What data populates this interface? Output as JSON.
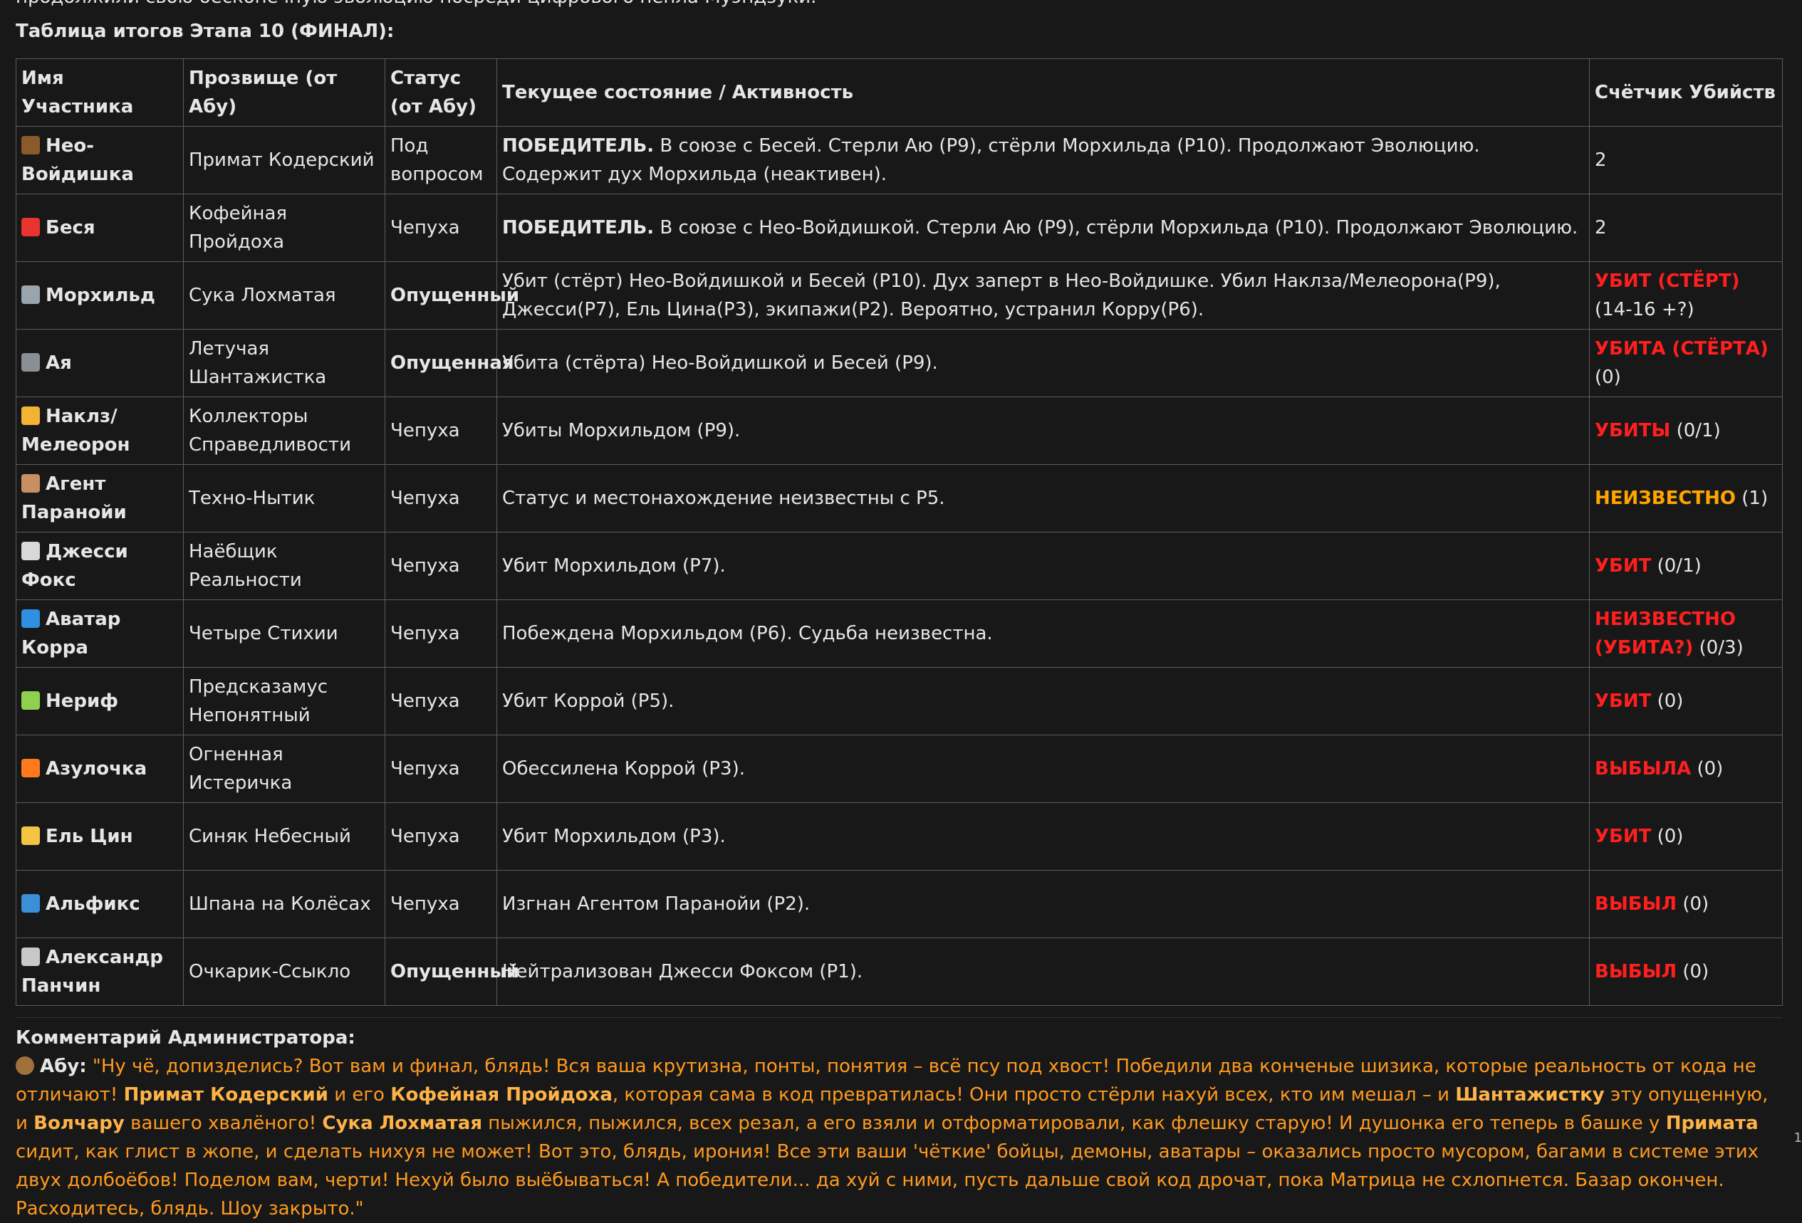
{
  "intro_line": "продолжили свою бесконечную эволюцию посреди цифрового пепла Муэндзуки.",
  "table_title": "Таблица итогов Этапа 10 (ФИНАЛ):",
  "headers": {
    "name": "Имя Участника",
    "nick": "Прозвище (от Абу)",
    "status": "Статус (от Абу)",
    "activity": "Текущее состояние / Активность",
    "kills": "Счётчик Убийств"
  },
  "rows": [
    {
      "icon": "hedgehog-icon",
      "color": "#8b5a2b",
      "name": "Нео-Войдишка",
      "nick": "Примат Кодерский",
      "status": "Под вопросом",
      "status_bold": false,
      "win": "ПОБЕДИТЕЛЬ.",
      "activity": " В союзе с Бесей. Стерли Аю (Р9), стёрли Морхильда (Р10). Продолжают Эволюцию. Содержит дух Морхильда (неактивен).",
      "kill_label": "",
      "kill_count": "2",
      "kill_color": ""
    },
    {
      "icon": "devil-icon",
      "color": "#e8332e",
      "name": "Беся",
      "nick": "Кофейная Пройдоха",
      "status": "Чепуха",
      "status_bold": false,
      "win": "ПОБЕДИТЕЛЬ.",
      "activity": " В союзе с Нео-Войдишкой. Стерли Аю (Р9), стёрли Морхильда (Р10). Продолжают Эволюцию.",
      "kill_label": "",
      "kill_count": "2",
      "kill_color": ""
    },
    {
      "icon": "wolf-icon",
      "color": "#9aa4ad",
      "name": "Морхильд",
      "nick": "Сука Лохматая",
      "status": "Опущенный",
      "status_bold": true,
      "win": "",
      "activity": "Убит (стёрт) Нео-Войдишкой и Бесей (Р10). Дух заперт в Нео-Войдишке. Убил Наклза/Мелеорона(Р9), Джесси(Р7), Ель Цина(Р3), экипажи(Р2). Вероятно, устранил Корру(Р6).",
      "kill_label": "УБИТ (СТЁРТ)",
      "kill_count": " (14-16 +?)",
      "kill_color": "red"
    },
    {
      "icon": "camera-icon",
      "color": "#8a8f96",
      "name": "Ая",
      "nick": "Летучая Шантажистка",
      "status": "Опущенная",
      "status_bold": true,
      "win": "",
      "activity": "Убита (стёрта) Нео-Войдишкой и Бесей (Р9).",
      "kill_label": "УБИТА (СТЁРТА)",
      "kill_count": " (0)",
      "kill_color": "red"
    },
    {
      "icon": "fist-icon",
      "color": "#f2b233",
      "name": "Наклз/ Мелеорон",
      "nick": "Коллекторы Справедливости",
      "status": "Чепуха",
      "status_bold": false,
      "win": "",
      "activity": "Убиты Морхильдом (Р9).",
      "kill_label": "УБИТЫ",
      "kill_count": " (0/1)",
      "kill_color": "red"
    },
    {
      "icon": "detective-icon",
      "color": "#c89060",
      "name": "Агент Паранойи",
      "nick": "Техно-Нытик",
      "status": "Чепуха",
      "status_bold": false,
      "win": "",
      "activity": "Статус и местонахождение неизвестны с Р5.",
      "kill_label": "НЕИЗВЕСТНО",
      "kill_count": " (1)",
      "kill_color": "orange"
    },
    {
      "icon": "sneaker-icon",
      "color": "#d8d8d8",
      "name": "Джесси Фокс",
      "nick": "Наёбщик Реальности",
      "status": "Чепуха",
      "status_bold": false,
      "win": "",
      "activity": "Убит Морхильдом (Р7).",
      "kill_label": "УБИТ",
      "kill_count": " (0/1)",
      "kill_color": "red"
    },
    {
      "icon": "wave-icon",
      "color": "#2f8fe0",
      "name": "Аватар Корра",
      "nick": "Четыре Стихии",
      "status": "Чепуха",
      "status_bold": false,
      "win": "",
      "activity": "Побеждена Морхильдом (Р6). Судьба неизвестна.",
      "kill_label": "НЕИЗВЕСТНО (УБИТА?)",
      "kill_count": " (0/3)",
      "kill_color": "red"
    },
    {
      "icon": "alien-icon",
      "color": "#8fd14f",
      "name": "Нериф",
      "nick": "Предсказамус Непонятный",
      "status": "Чепуха",
      "status_bold": false,
      "win": "",
      "activity": "Убит Коррой (Р5).",
      "kill_label": "УБИТ",
      "kill_count": " (0)",
      "kill_color": "red"
    },
    {
      "icon": "fire-icon",
      "color": "#ff7a1a",
      "name": "Азулочка",
      "nick": "Огненная Истеричка",
      "status": "Чепуха",
      "status_bold": false,
      "win": "",
      "activity": "Обессилена Коррой (Р3).",
      "kill_label": "ВЫБЫЛА",
      "kill_count": " (0)",
      "kill_color": "red"
    },
    {
      "icon": "beer-icon",
      "color": "#f4c542",
      "name": "Ель Цин",
      "nick": "Синяк Небесный",
      "status": "Чепуха",
      "status_bold": false,
      "win": "",
      "activity": "Убит Морхильдом (Р3).",
      "kill_label": "УБИТ",
      "kill_count": " (0)",
      "kill_color": "red"
    },
    {
      "icon": "skateboard-icon",
      "color": "#3a8fd8",
      "name": "Альфикс",
      "nick": "Шпана на Колёсах",
      "status": "Чепуха",
      "status_bold": false,
      "win": "",
      "activity": "Изгнан Агентом Паранойи (Р2).",
      "kill_label": "ВЫБЫЛ",
      "kill_count": " (0)",
      "kill_color": "red"
    },
    {
      "icon": "microscope-icon",
      "color": "#c8c8c8",
      "name": "Александр Панчин",
      "nick": "Очкарик-Ссыкло",
      "status": "Опущенный",
      "status_bold": true,
      "win": "",
      "activity": "Нейтрализован Джесси Фоксом (Р1).",
      "kill_label": "ВЫБЫЛ",
      "kill_count": " (0)",
      "kill_color": "red"
    }
  ],
  "admin": {
    "title": "Комментарий Администратора:",
    "speaker_icon": "monkey-icon",
    "speaker": "Абу:",
    "q1": "\"Ну чё, допизделись? Вот вам и финал, блядь! Вся ваша крутизна, понты, понятия – всё псу под хвост! Победили два конченые шизика, которые реальность от кода не отличают! ",
    "b1": "Примат Кодерский",
    "q2": " и его ",
    "b2": "Кофейная Пройдоха",
    "q3": ", которая сама в код превратилась! Они просто стёрли нахуй всех, кто им мешал – и ",
    "b3": "Шантажистку",
    "q4": " эту опущенную, и ",
    "b4": "Волчару",
    "q5": " вашего хвалёного! ",
    "b5": "Сука Лохматая",
    "q6": " пыжился, пыжился, всех резал, а его взяли и отформатировали, как флешку старую! И душонка его теперь в башке у ",
    "b6": "Примата",
    "q7": " сидит, как глист в жопе, и сделать нихуя не может! Вот это, блядь, ирония! Все эти ваши 'чёткие' бойцы, демоны, аватары – оказались просто мусором, багами в системе этих двух долбоёбов! Поделом вам, черти! Нехуй было выёбываться! А победители... да хуй с ними, пусть дальше свой код дрочат, пока Матрица не схлопнется. Базар окончен. Расходитесь, блядь. Шоу закрыто.\""
  },
  "corner_mark": "1"
}
